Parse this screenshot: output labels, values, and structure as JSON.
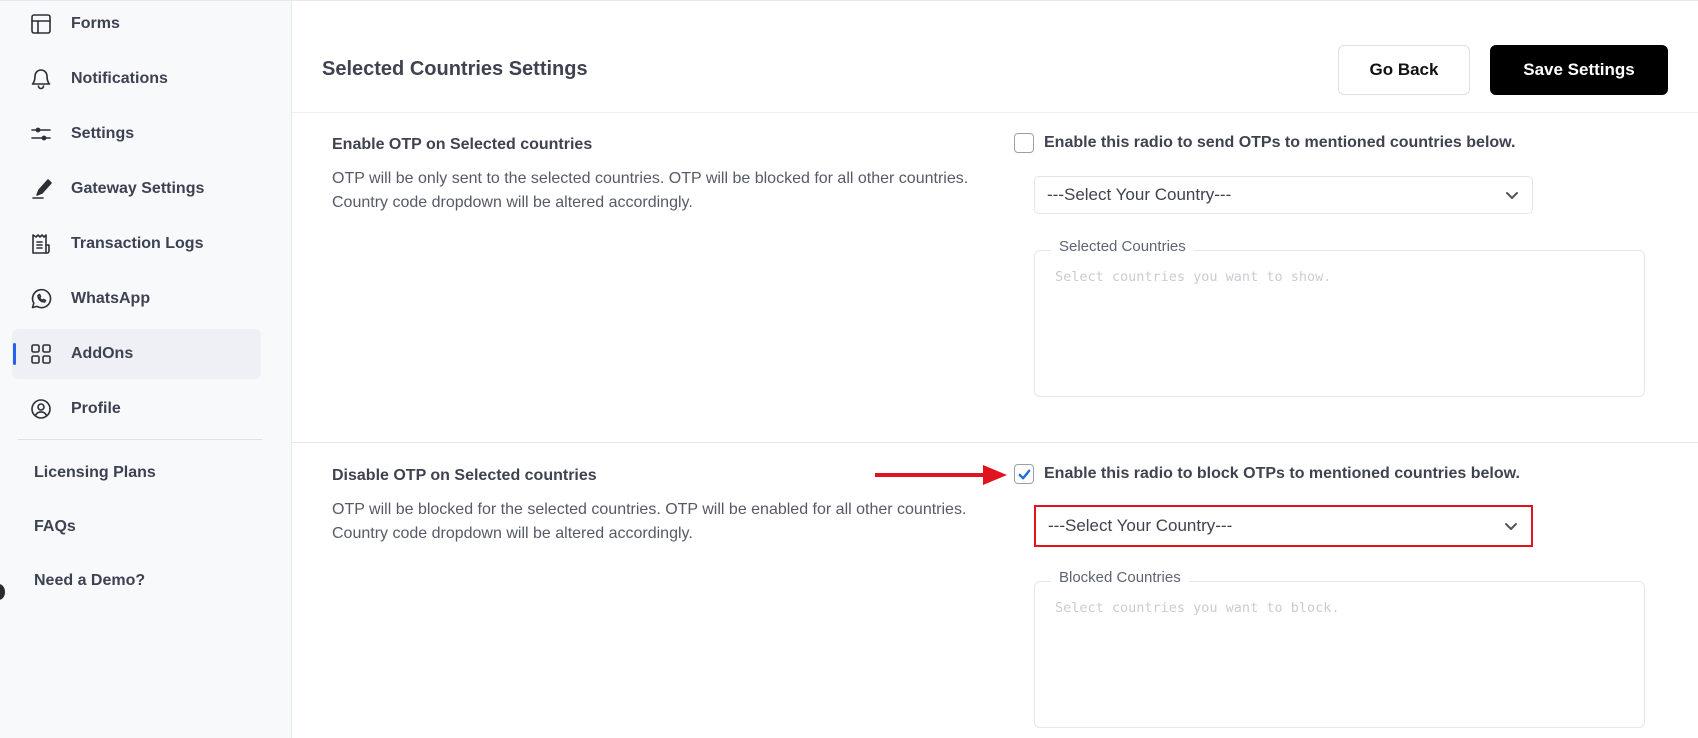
{
  "sidebar": {
    "items": [
      {
        "label": "Forms",
        "icon": "layout-icon"
      },
      {
        "label": "Notifications",
        "icon": "bell-icon"
      },
      {
        "label": "Settings",
        "icon": "sliders-icon"
      },
      {
        "label": "Gateway Settings",
        "icon": "pen-icon"
      },
      {
        "label": "Transaction Logs",
        "icon": "receipt-icon"
      },
      {
        "label": "WhatsApp",
        "icon": "whatsapp-icon"
      },
      {
        "label": "AddOns",
        "icon": "grid-icon",
        "active": true
      },
      {
        "label": "Profile",
        "icon": "user-circle-icon"
      }
    ],
    "links": [
      {
        "label": "Licensing Plans"
      },
      {
        "label": "FAQs"
      },
      {
        "label": "Need a Demo?"
      }
    ]
  },
  "header": {
    "title": "Selected Countries Settings",
    "go_back_label": "Go Back",
    "save_label": "Save Settings"
  },
  "sections": {
    "enable": {
      "title": "Enable OTP on Selected countries",
      "desc_line1": "OTP will be only sent to the selected countries. OTP will be blocked for all other countries.",
      "desc_line2": "Country code dropdown will be altered accordingly.",
      "checkbox_label": "Enable this radio to send OTPs to mentioned countries below.",
      "checked": false,
      "select_value": "---Select Your Country---",
      "list_legend": "Selected Countries",
      "list_placeholder": "Select countries you want to show."
    },
    "disable": {
      "title": "Disable OTP on Selected countries",
      "desc_line1": "OTP will be blocked for the selected countries. OTP will be enabled for all other countries.",
      "desc_line2": "Country code dropdown will be altered accordingly.",
      "checkbox_label": "Enable this radio to block OTPs to mentioned countries below.",
      "checked": true,
      "select_value": "---Select Your Country---",
      "list_legend": "Blocked Countries",
      "list_placeholder": "Select countries you want to block."
    }
  },
  "colors": {
    "accent": "#2563eb",
    "save_button_bg": "#000000",
    "highlight": "#e0141e",
    "checkmark": "#2271d8"
  }
}
